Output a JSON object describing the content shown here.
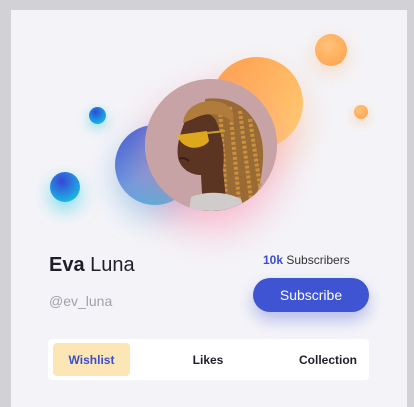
{
  "profile": {
    "first_name": "Eva",
    "last_name": "Luna",
    "handle": "@ev_luna",
    "subscribers_count": "10k",
    "subscribers_label": " Subscribers",
    "subscribe_label": "Subscribe"
  },
  "tabs": [
    {
      "label": "Wishlist",
      "active": true
    },
    {
      "label": "Likes",
      "active": false
    },
    {
      "label": "Collection",
      "active": false
    }
  ],
  "colors": {
    "accent": "#3e54d2",
    "active_tab_bg": "#fde6b6",
    "orange": "#ff9f47",
    "cyan": "#13d4e8"
  }
}
